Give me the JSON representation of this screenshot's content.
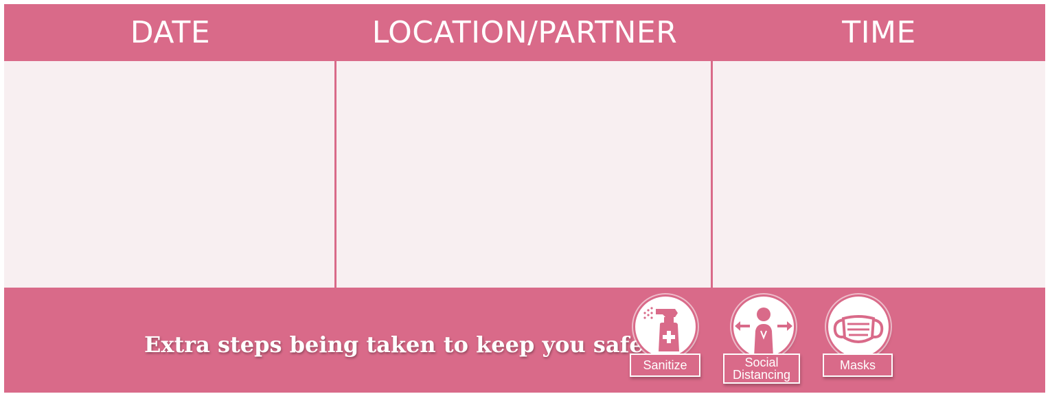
{
  "header": {
    "date_label": "DATE",
    "location_label": "LOCATION/PARTNER",
    "time_label": "TIME"
  },
  "table": {
    "rows": []
  },
  "footer": {
    "tagline": "Extra steps being taken to keep you safe",
    "badges": [
      {
        "icon": "spray-bottle-icon",
        "label": "Sanitize"
      },
      {
        "icon": "social-distancing-icon",
        "label_line1": "Social",
        "label_line2": "Distancing"
      },
      {
        "icon": "face-mask-icon",
        "label": "Masks"
      }
    ]
  },
  "colors": {
    "brand_pink": "#d96a89",
    "cell_background": "#f8eff1",
    "text_light": "#ffffff"
  }
}
